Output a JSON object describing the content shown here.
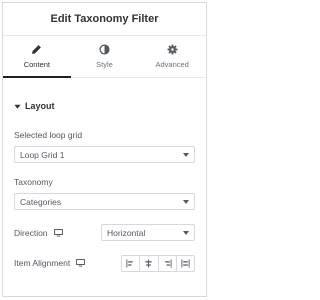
{
  "header": {
    "title": "Edit Taxonomy Filter"
  },
  "tabs": [
    {
      "label": "Content",
      "icon": "pencil-icon",
      "active": true
    },
    {
      "label": "Style",
      "icon": "half-circle-icon",
      "active": false
    },
    {
      "label": "Advanced",
      "icon": "gear-icon",
      "active": false
    }
  ],
  "section": {
    "title": "Layout",
    "icon": "caret-down-icon"
  },
  "controls": {
    "loop_grid": {
      "label": "Selected loop grid",
      "value": "Loop Grid 1"
    },
    "taxonomy": {
      "label": "Taxonomy",
      "value": "Categories"
    },
    "direction": {
      "label": "Direction",
      "value": "Horizontal"
    },
    "item_alignment": {
      "label": "Item Alignment",
      "options": [
        "align-start-icon",
        "align-center-icon",
        "align-end-icon",
        "align-justify-icon"
      ]
    }
  },
  "colors": {
    "border": "#d5d8dc",
    "text": "#515962",
    "heading": "#2f3338",
    "active_tab": "#1f2124"
  }
}
